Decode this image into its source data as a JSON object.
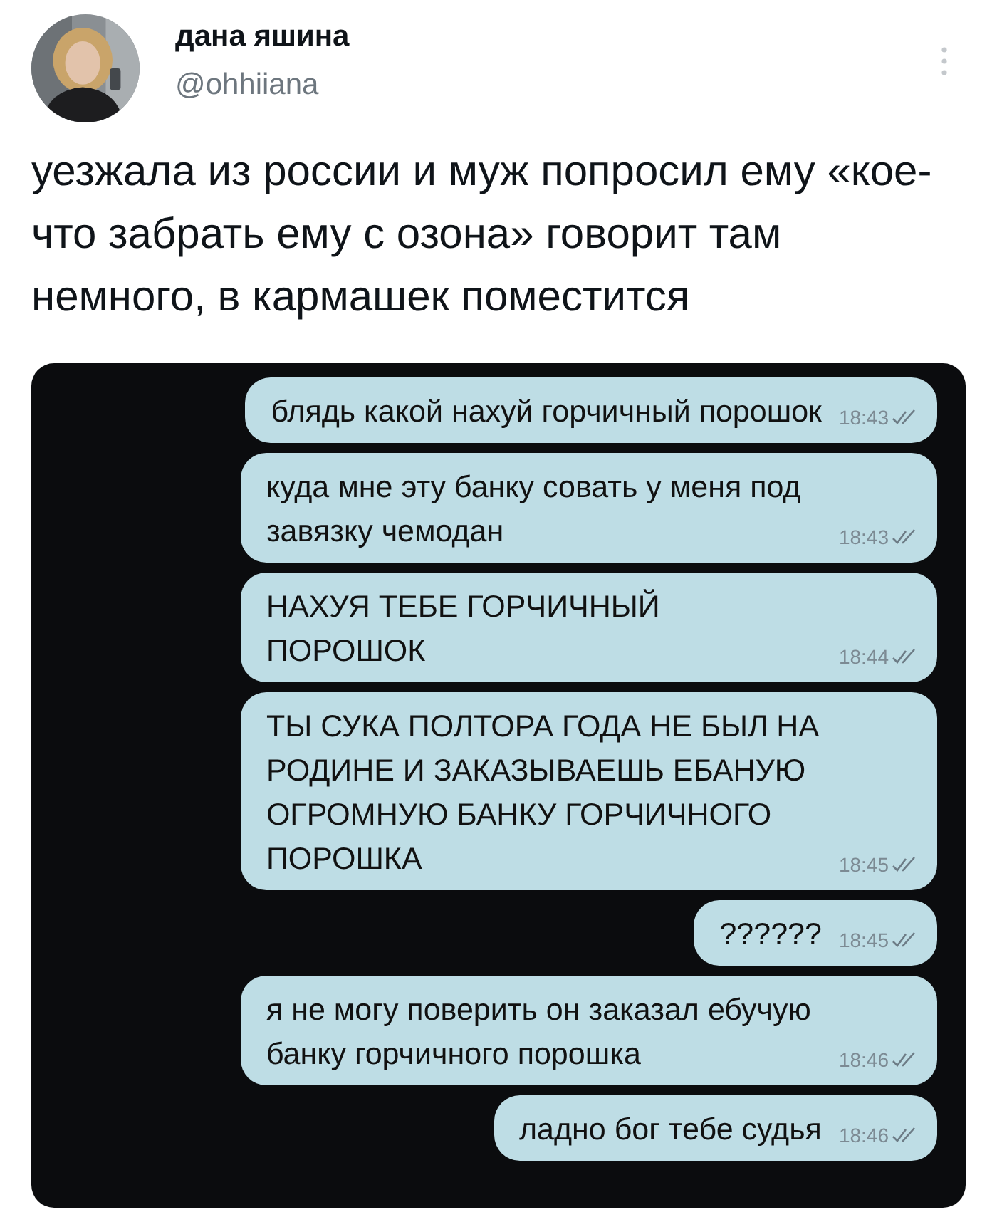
{
  "author": {
    "name": "дана яшина",
    "handle": "@ohhiiana"
  },
  "tweet_text": "уезжала из россии и муж попросил ему «кое-что забрать ему с озона» говорит там немного, в кармашек поместится",
  "chat": {
    "messages": [
      {
        "text": "блядь какой нахуй горчичный порошок",
        "time": "18:43"
      },
      {
        "text": "куда мне эту банку совать у меня под завязку чемодан",
        "time": "18:43"
      },
      {
        "text": "НАХУЯ ТЕБЕ ГОРЧИЧНЫЙ ПОРОШОК",
        "time": "18:44"
      },
      {
        "text": "ТЫ СУКА ПОЛТОРА ГОДА НЕ БЫЛ НА РОДИНЕ И ЗАКАЗЫВАЕШЬ ЕБАНУЮ ОГРОМНУЮ БАНКУ ГОРЧИЧНОГО ПОРОШКА",
        "time": "18:45"
      },
      {
        "text": "??????",
        "time": "18:45"
      },
      {
        "text": "я не могу поверить он заказал ебучую банку горчичного порошка",
        "time": "18:46"
      },
      {
        "text": "ладно бог тебе судья",
        "time": "18:46"
      }
    ]
  }
}
